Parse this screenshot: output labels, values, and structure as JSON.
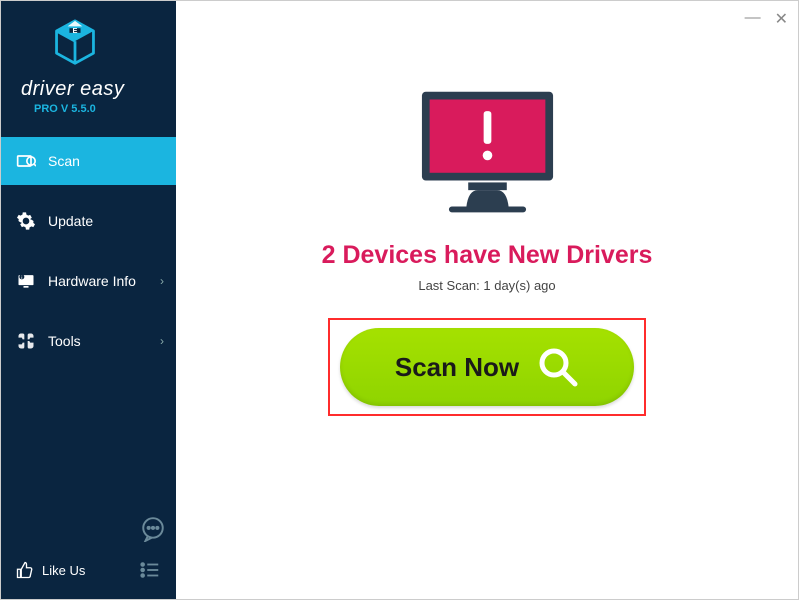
{
  "brand": {
    "name": "driver easy",
    "version": "PRO V 5.5.0"
  },
  "sidebar": {
    "items": [
      {
        "label": "Scan",
        "active": true
      },
      {
        "label": "Update",
        "active": false
      },
      {
        "label": "Hardware Info",
        "active": false,
        "chevron": true
      },
      {
        "label": "Tools",
        "active": false,
        "chevron": true
      }
    ],
    "like_label": "Like Us"
  },
  "main": {
    "headline": "2 Devices have New Drivers",
    "last_scan": "Last Scan: 1 day(s) ago",
    "scan_button": "Scan Now"
  },
  "colors": {
    "accent": "#1BB5E0",
    "sidebar_bg": "#0a2540",
    "headline": "#D91B5C",
    "scan_green": "#8FD400",
    "highlight_red": "#FF2C2C"
  }
}
